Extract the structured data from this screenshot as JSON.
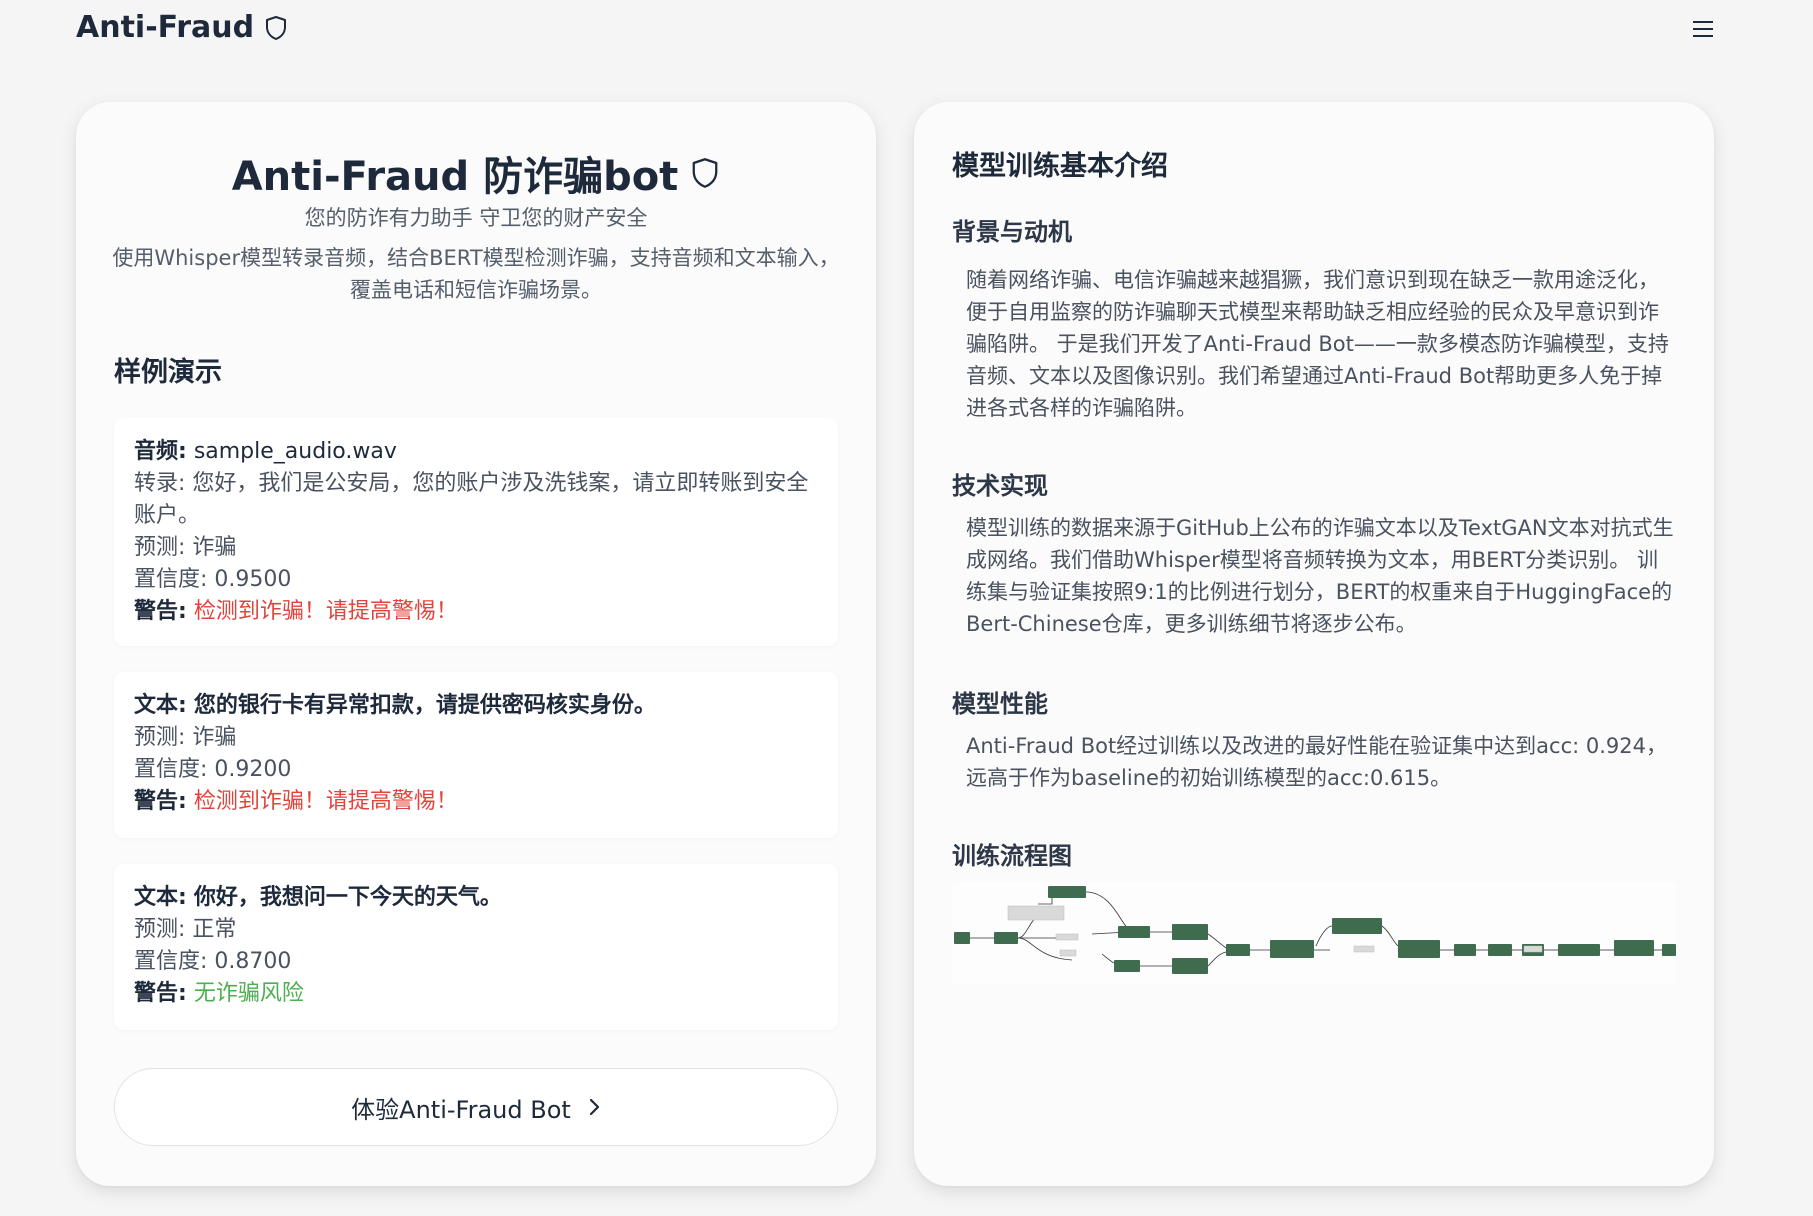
{
  "brand": {
    "name": "Anti-Fraud"
  },
  "left": {
    "title": "Anti-Fraud 防诈骗bot",
    "subtitle": "您的防诈有力助手 守卫您的财产安全",
    "description": "使用Whisper模型转录音频，结合BERT模型检测诈骗，支持音频和文本输入，覆盖电话和短信诈骗场景。",
    "section_title": "样例演示",
    "examples": [
      {
        "head_label": "音频:",
        "head_value": "sample_audio.wav",
        "transcript_label": "转录:",
        "transcript_value": "您好，我们是公安局，您的账户涉及洗钱案，请立即转账到安全账户。",
        "pred": "预测: 诈骗",
        "conf": "置信度: 0.9500",
        "warn_label": "警告:",
        "warn_value": "检测到诈骗！请提高警惕！"
      },
      {
        "head_label": "文本:",
        "head_value": "您的银行卡有异常扣款，请提供密码核实身份。",
        "pred": "预测: 诈骗",
        "conf": "置信度: 0.9200",
        "warn_label": "警告:",
        "warn_value": "检测到诈骗！请提高警惕！"
      },
      {
        "head_label": "文本:",
        "head_value": "你好，我想问一下今天的天气。",
        "pred": "预测: 正常",
        "conf": "置信度: 0.8700",
        "warn_label": "警告:",
        "warn_value": "无诈骗风险"
      }
    ],
    "cta_label": "体验Anti-Fraud Bot"
  },
  "right": {
    "title": "模型训练基本介绍",
    "sections": [
      {
        "heading": "背景与动机",
        "body": "随着网络诈骗、电信诈骗越来越猖獗，我们意识到现在缺乏一款用途泛化，便于自用监察的防诈骗聊天式模型来帮助缺乏相应经验的民众及早意识到诈骗陷阱。 于是我们开发了Anti-Fraud Bot——一款多模态防诈骗模型，支持音频、文本以及图像识别。我们希望通过Anti-Fraud Bot帮助更多人免于掉进各式各样的诈骗陷阱。"
      },
      {
        "heading": "技术实现",
        "body": "模型训练的数据来源于GitHub上公布的诈骗文本以及TextGAN文本对抗式生成网络。我们借助Whisper模型将音频转换为文本，用BERT分类识别。 训练集与验证集按照9:1的比例进行划分，BERT的权重来自于HuggingFace的Bert-Chinese仓库，更多训练细节将逐步公布。"
      },
      {
        "heading": "模型性能",
        "body": "Anti-Fraud Bot经过训练以及改进的最好性能在验证集中达到acc: 0.924，远高于作为baseline的初始训练模型的acc:0.615。"
      },
      {
        "heading": "训练流程图"
      }
    ]
  },
  "colors": {
    "fraud": "#e0443b",
    "safe": "#4caf50",
    "flow_node": "#3f6b4f"
  }
}
